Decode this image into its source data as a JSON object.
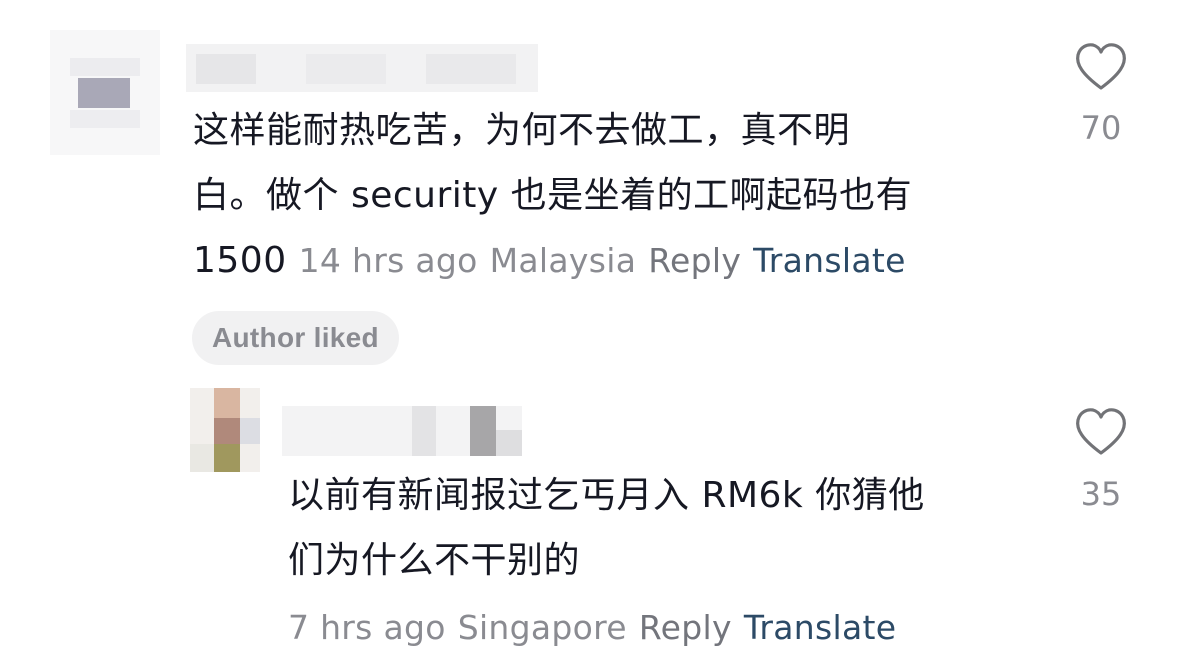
{
  "comments": [
    {
      "line1": "这样能耐热吃苦，为何不去做工，真不明",
      "line2": "白。做个 security 也是坐着的工啊起码也有",
      "line3_prefix": "1500",
      "time": "14 hrs ago",
      "location": "Malaysia",
      "reply_label": "Reply",
      "translate_label": "Translate",
      "like_count": "70",
      "badge": "Author liked"
    },
    {
      "line1": "以前有新闻报过乞丐月入 RM6k 你猜他",
      "line2": "们为什么不干别的",
      "time": "7 hrs ago",
      "location": "Singapore",
      "reply_label": "Reply",
      "translate_label": "Translate",
      "like_count": "35"
    }
  ],
  "colors": {
    "text": "#161823",
    "meta": "#8a8b91",
    "translate": "#2c4a66",
    "badge_bg": "#f1f1f2"
  }
}
